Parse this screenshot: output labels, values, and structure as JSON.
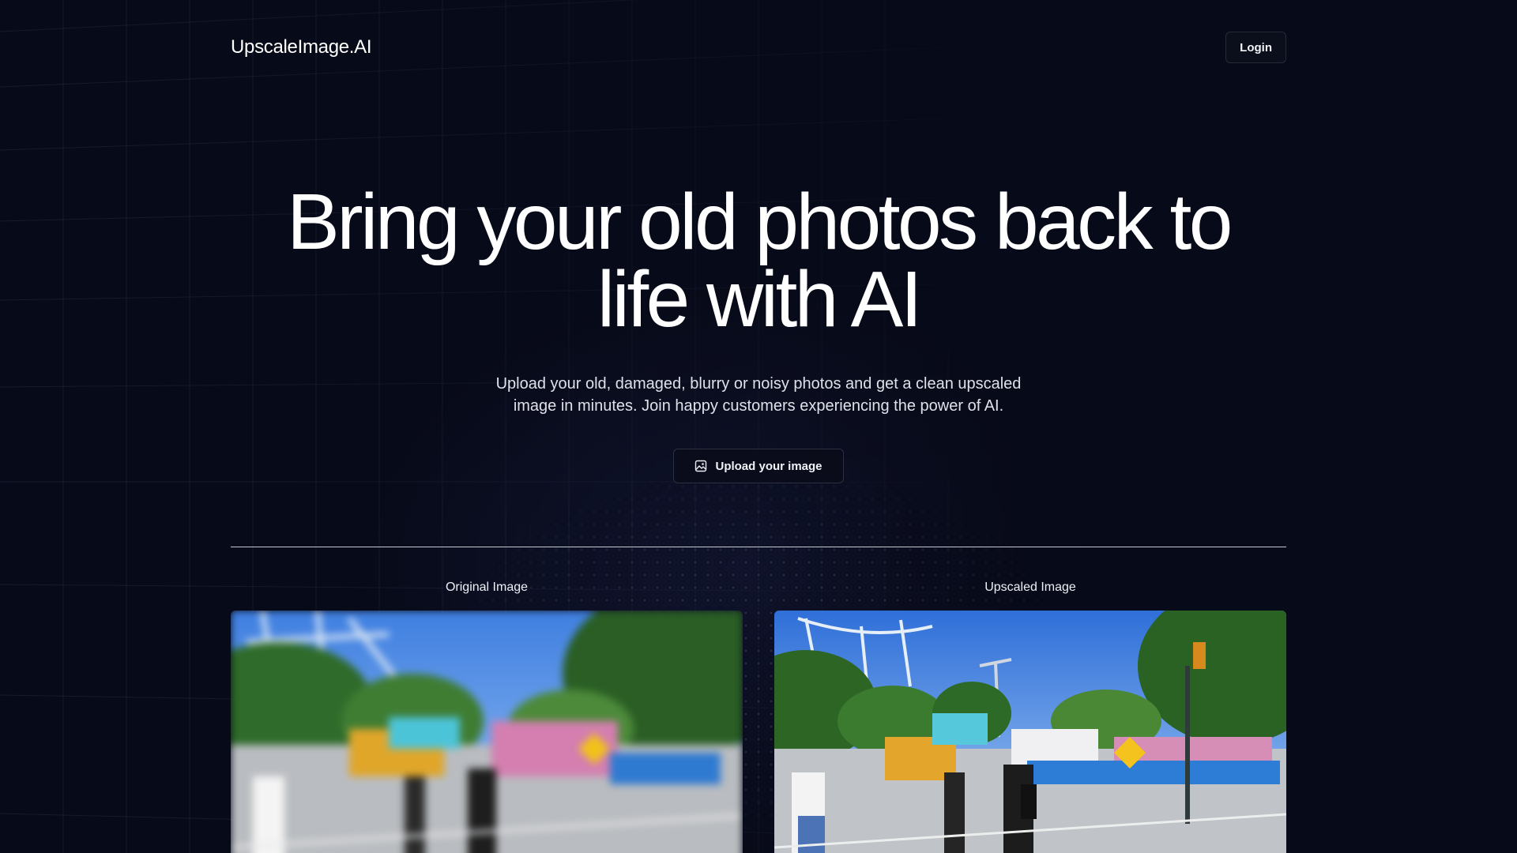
{
  "brand": {
    "name": "UpscaleImage.AI"
  },
  "nav": {
    "login_label": "Login"
  },
  "hero": {
    "title_line1": "Bring your old photos back to",
    "title_line2": "life with AI",
    "subtitle_line1": "Upload your old, damaged, blurry or noisy photos and get a clean upscaled",
    "subtitle_line2": "image in minutes. Join happy customers experiencing the power of AI.",
    "upload_label": "Upload your image",
    "upload_icon": "image-icon"
  },
  "comparison": {
    "original_label": "Original Image",
    "upscaled_label": "Upscaled Image"
  },
  "colors": {
    "background": "#070a18",
    "text": "#ffffff",
    "muted_text": "#dfe1ea",
    "border": "#262a3a"
  }
}
